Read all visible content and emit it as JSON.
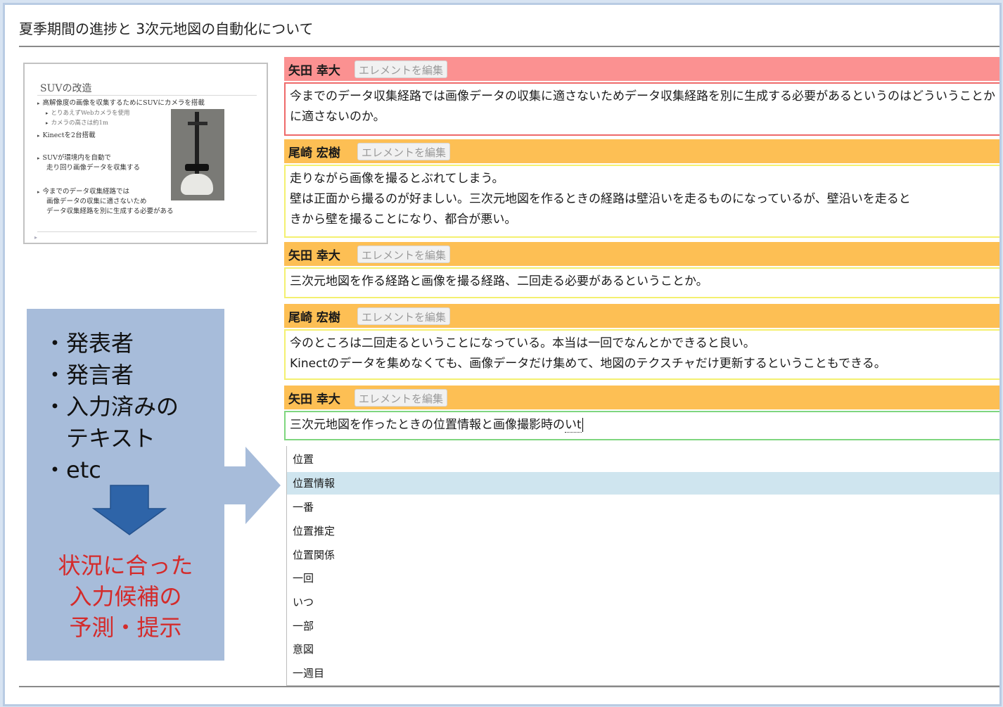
{
  "page": {
    "title": "夏季期間の進捗と 3次元地図の自動化について"
  },
  "slide": {
    "title": "SUVの改造",
    "bullets": [
      {
        "text": "高解像度の画像を収集するためにSUVにカメラを搭載",
        "sub": false
      },
      {
        "text": "とりあえずWebカメラを使用",
        "sub": true
      },
      {
        "text": "カメラの高さは約1m",
        "sub": true
      },
      {
        "text": "Kinectを2台搭載",
        "sub": false
      },
      {
        "text": "SUVが環境内を自動で",
        "sub": false
      },
      {
        "text": "走り回り画像データを収集する",
        "sub": false,
        "cont": true
      },
      {
        "text": "今までのデータ収集経路では",
        "sub": false
      },
      {
        "text": "画像データの収集に適さないため",
        "sub": false,
        "cont": true
      },
      {
        "text": "データ収集経路を別に生成する必要がある",
        "sub": false,
        "cont": true
      }
    ]
  },
  "callout": {
    "items": [
      "・発表者",
      "・発言者",
      "・入力済みの",
      "　テキスト",
      "・etc"
    ],
    "prediction": [
      "状況に合った",
      "入力候補の",
      "予測・提示"
    ]
  },
  "edit_label": "エレメントを編集",
  "comments": [
    {
      "speaker": "矢田 幸大",
      "color": "#fb9191",
      "lines": [
        "今までのデータ収集経路では画像データの収集に適さないためデータ収集経路を別に生成する必要があるというのはどういうことか",
        "に適さないのか。"
      ]
    },
    {
      "speaker": "尾崎 宏樹",
      "color": "#fdbf54",
      "lines": [
        "走りながら画像を撮るとぶれてしまう。",
        "壁は正面から撮るのが好ましい。三次元地図を作るときの経路は壁沿いを走るものになっているが、壁沿いを走ると",
        "きから壁を撮ることになり、都合が悪い。"
      ]
    },
    {
      "speaker": "矢田 幸大",
      "color": "#fdbf54",
      "lines": [
        "三次元地図を作る経路と画像を撮る経路、二回走る必要があるということか。"
      ]
    },
    {
      "speaker": "尾崎 宏樹",
      "color": "#fdbf54",
      "lines": [
        "今のところは二回走るということになっている。本当は一回でなんとかできると良い。",
        "Kinectのデータを集めなくても、画像データだけ集めて、地図のテクスチャだけ更新するということもできる。"
      ]
    }
  ],
  "input_card": {
    "speaker": "矢田 幸大",
    "value": "三次元地図を作ったときの位置情報と画像撮影時の",
    "composing": "いt"
  },
  "suggestions": {
    "selected_index": 1,
    "items": [
      "位置",
      "位置情報",
      "一番",
      "位置推定",
      "位置関係",
      "一回",
      "いつ",
      "一部",
      "意図",
      "一週目"
    ]
  }
}
